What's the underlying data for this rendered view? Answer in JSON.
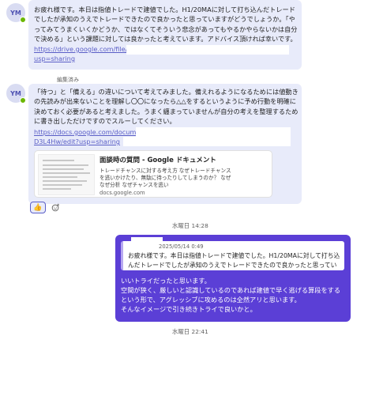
{
  "message1": {
    "avatar_initials": "YM",
    "text": "お疲れ様です。本日は指値トレードで建値でした。H1/20MAに対して打ち込んだトレードでしたが承知のうえでトレードできたので良かったと思っていますがどうでしょうか。「やってみてうまくいくかどうか、ではなくてそういう悲念があってもやるかやらないかは自分で決める」という課題に対しては良かったと考えています。アドバイス頂ければ幸いです。",
    "link_line1": "https://drive.google.com/file/d",
    "link_line2": "usp=sharing"
  },
  "message2": {
    "avatar_initials": "YM",
    "edited_label": "編集済み",
    "text": "「待つ」と「備える」の違いについて考えてみました。備えれるようになるためには値動きの先読みが出来ないことを理解し〇〇になったら△△をするというように予め行動を明確に決めておく必要があると考えました。うまく纏まっていませんが自分の考えを整理するために書き出しただけですのでスルーしてください。",
    "link_line1": "https://docs.google.com/documen",
    "link_line2": "D3L4Hw/edit?usp=sharing",
    "card": {
      "title": "面談時の質問 - Google ドキュメント",
      "description": "トレードチャンスに対する考え方 なぜトレードチャンスを逃いかけたり、無駄に待ったりしてしまうのか？ なぜなぜ分析 なぜチャンスを逃い",
      "domain": "docs.google.com"
    },
    "reactions": [
      {
        "emoji": "👍",
        "icon": "thumbs-up-icon"
      },
      {
        "emoji": "☺",
        "icon": "add-reaction-icon"
      }
    ]
  },
  "timestamp1": "水曜日 14:28",
  "reply": {
    "quote_meta": "2025/05/14 0:49",
    "quote_text": "お疲れ様です。本日は指値トレードで建値でした。H1/20MAに対して打ち込んだトレードでしたが承知のうえでトレードできたので良かったと思っていますがどうでしょうか。",
    "lines": [
      "いいトライだったと思います。",
      "空間が狭く、厳しいと認識しているのであれば建値で早く逃げる算段をする",
      "という形で、アグレッシブに攻めるのは全然アリと思います。",
      "そんなイメージで引き続きトライで良いかと。"
    ]
  },
  "timestamp2": "水曜日 22:41",
  "colors": {
    "incoming_bubble": "#e8ebfa",
    "outgoing_bubble": "#5b3fd6",
    "link": "#5b5fc7",
    "presence": "#6bb700"
  }
}
